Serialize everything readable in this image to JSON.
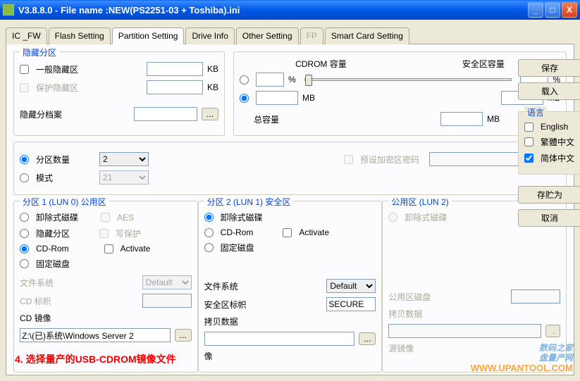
{
  "window": {
    "title": "V3.8.8.0 - File name :NEW(PS2251-03 + Toshiba).ini",
    "min": "_",
    "max": "□",
    "close": "X"
  },
  "tabs": [
    "IC _FW",
    "Flash Setting",
    "Partition Setting",
    "Drive Info",
    "Other Setting",
    "FP",
    "Smart Card Setting"
  ],
  "hiddenPartition": {
    "title": "隐藏分区",
    "normal": "一般隐藏区",
    "protect": "保护隐藏区",
    "kb": "KB",
    "archive": "隐藏分档案",
    "browse": "..."
  },
  "cdrom": {
    "title_cd": "CDROM 容量",
    "title_safe": "安全区容量",
    "pct": "%",
    "mb": "MB",
    "total": "总容量"
  },
  "partCount": {
    "countLabel": "分区数量",
    "countValue": "2",
    "modeLabel": "模式",
    "modeValue": "21",
    "presetPw": "预设加密区密码"
  },
  "lun0": {
    "title": "分区 1 (LUN 0) 公用区",
    "remove": "卸除式磁碟",
    "hidden": "隐藏分区",
    "cdrom": "CD-Rom",
    "fixed": "固定磁盘",
    "aes": "AES",
    "wp": "写保护",
    "activate": "Activate",
    "fs": "文件系统",
    "fsVal": "Default",
    "cdLabel": "CD 标帜",
    "cdImage": "CD 镜像",
    "cdPath": "Z:\\(已)系统\\Windows Server 2",
    "browse": "..."
  },
  "lun1": {
    "title": "分区 2 (LUN 1) 安全区",
    "remove": "卸除式磁碟",
    "cdrom": "CD-Rom",
    "activate": "Activate",
    "fixed": "固定磁盘",
    "fs": "文件系统",
    "fsVal": "Default",
    "safeLabel": "安全区标帜",
    "safeVal": "SECURE",
    "copy": "拷贝数据",
    "browse": "...",
    "imageTail": "像"
  },
  "lun2": {
    "title": "公用区 (LUN 2)",
    "remove": "卸除式磁碟",
    "pubDisk": "公用区磁盘",
    "copy": "拷贝数据",
    "srcImage": "源镜像",
    "browse": ".."
  },
  "side": {
    "save": "保存",
    "load": "载入",
    "saveas": "存贮为",
    "cancel": "取消"
  },
  "lang": {
    "title": "语言",
    "en": "English",
    "tc": "繁體中文",
    "sc": "简体中文"
  },
  "note": "4. 选择量产的USB-CDROM镜像文件",
  "watermark": {
    "l1": "数码之家",
    "l2": "盘量产网",
    "url": "WWW.UPANTOOL.COM"
  }
}
